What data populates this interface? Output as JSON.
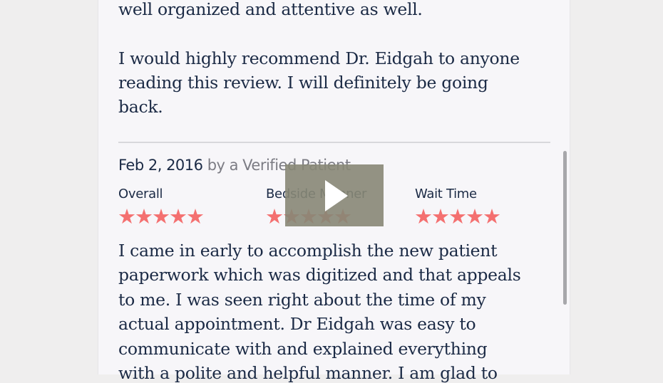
{
  "previous_review": {
    "lines": [
      "well organized and attentive as well.",
      "I would highly recommend Dr. Eidgah to anyone",
      "reading this review. I will definitely be going",
      "back."
    ]
  },
  "review": {
    "date": "Feb 2, 2016",
    "author": "by a Verified Patient",
    "ratings": [
      {
        "label": "Overall",
        "stars": 5,
        "stars_text": "★★★★★"
      },
      {
        "label": "Bedside Manner",
        "stars": 5,
        "stars_text": "★★★★★"
      },
      {
        "label": "Wait Time",
        "stars": 5,
        "stars_text": "★★★★★"
      }
    ],
    "lines": [
      "I came in early to accomplish the new patient",
      "paperwork which was digitized and that appeals",
      "to me. I was seen right about the time of my",
      "actual appointment. Dr Eidgah was easy to",
      "communicate with and explained everything",
      "with a polite and helpful manner. I am glad to"
    ]
  },
  "colors": {
    "star": "#f47070",
    "text": "#1b2a45",
    "muted": "#7c7c84"
  }
}
